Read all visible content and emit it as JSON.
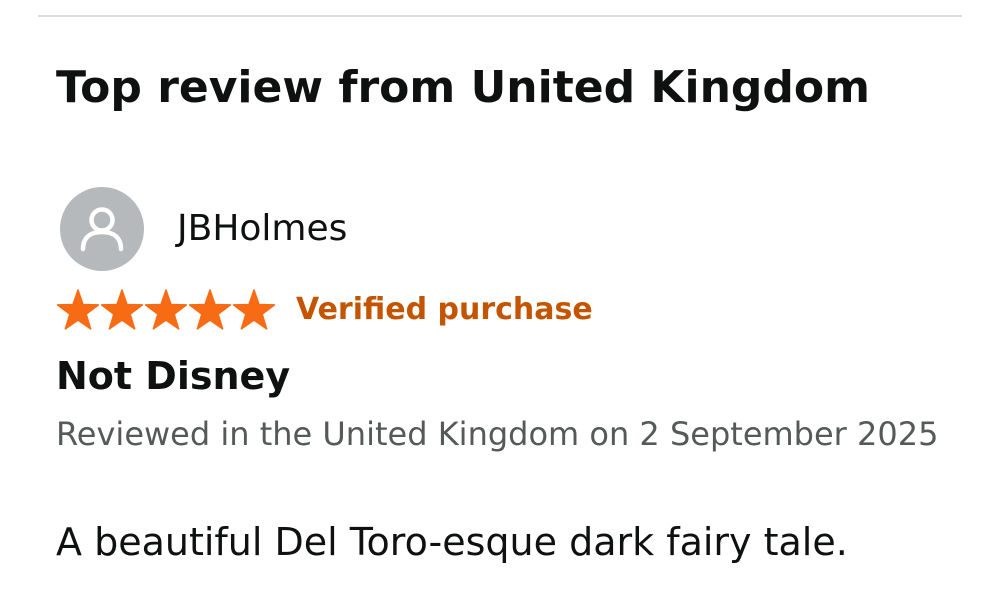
{
  "section": {
    "title": "Top review from United Kingdom"
  },
  "review": {
    "reviewer_name": "JBHolmes",
    "avatar_icon": "person-icon",
    "rating": 5,
    "rating_max": 5,
    "verified_label": "Verified purchase",
    "title": "Not Disney",
    "date_line": "Reviewed in the United Kingdom on 2 September 2025",
    "body": "A beautiful Del Toro-esque dark fairy tale."
  },
  "colors": {
    "star": "#f76b15",
    "verified": "#c45500",
    "avatar_bg": "#b5b9bc",
    "avatar_icon": "#ffffff",
    "text_primary": "#0f1111",
    "text_secondary": "#565959",
    "divider": "#dddddd"
  }
}
